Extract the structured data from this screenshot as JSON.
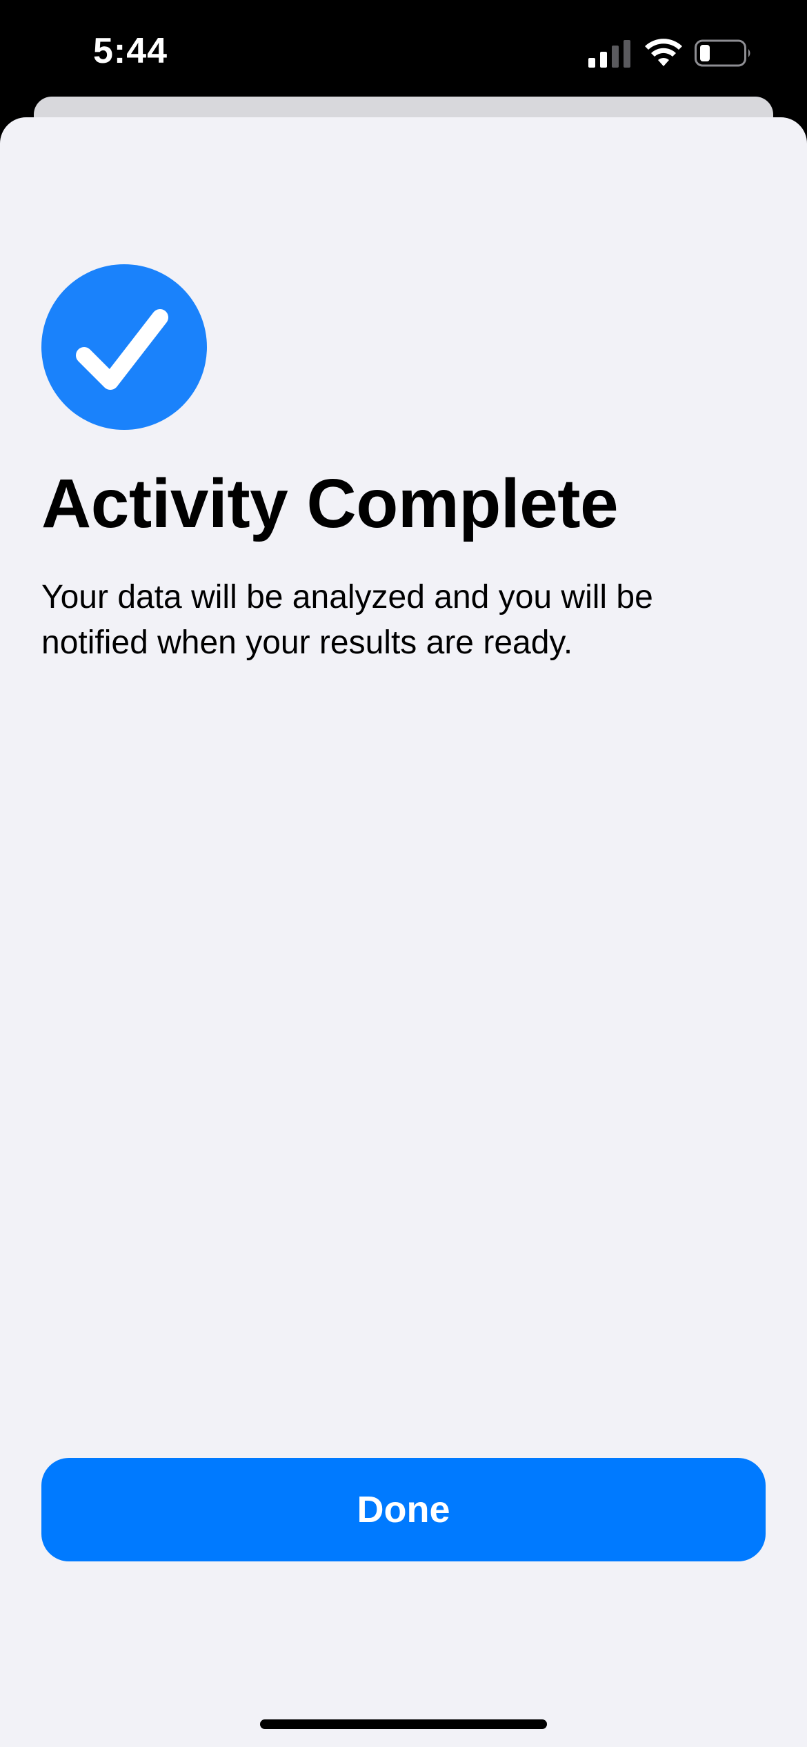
{
  "status_bar": {
    "time": "5:44",
    "icons": [
      "cellular-signal-icon",
      "wifi-icon",
      "battery-icon"
    ]
  },
  "content": {
    "icon": "checkmark-circle-icon",
    "title": "Activity Complete",
    "description": "Your data will be analyzed and you will be notified when your results are ready."
  },
  "actions": {
    "done_label": "Done"
  },
  "colors": {
    "accent": "#007aff",
    "background": "#f2f2f7",
    "status_bar": "#000000"
  }
}
